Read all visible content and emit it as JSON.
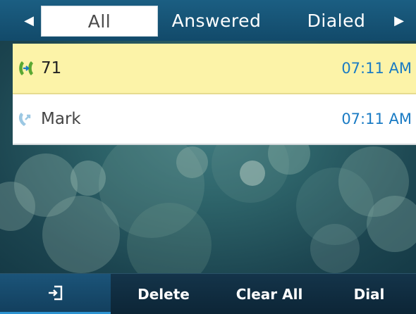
{
  "tabs": {
    "left_arrow_icon": "triangle-left-icon",
    "right_arrow_icon": "triangle-right-icon",
    "items": [
      {
        "label": "All"
      },
      {
        "label": "Answered"
      },
      {
        "label": "Dialed"
      }
    ]
  },
  "calls": [
    {
      "icon": "missed-call-icon",
      "name": "71",
      "time": "07:11 AM"
    },
    {
      "icon": "answered-call-icon",
      "name": "Mark",
      "time": "07:11 AM"
    }
  ],
  "softkeys": {
    "back_icon": "exit-icon",
    "delete_label": "Delete",
    "clear_all_label": "Clear All",
    "dial_label": "Dial"
  },
  "colors": {
    "accent": "#1a7bc4",
    "selected_row": "#fcf3a8",
    "missed_icon": "#5aa832"
  }
}
